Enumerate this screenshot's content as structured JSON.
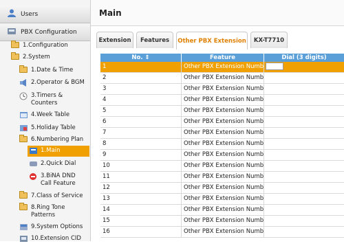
{
  "sidebar": {
    "users_label": "Users",
    "pbx_label": "PBX Configuration",
    "items": [
      {
        "label": "1.Configuration"
      },
      {
        "label": "2.System"
      },
      {
        "label": "1.Date & Time"
      },
      {
        "label": "2.Operator & BGM"
      },
      {
        "label": "3.Timers &"
      },
      {
        "label": "Counters"
      },
      {
        "label": "4.Week Table"
      },
      {
        "label": "5.Holiday Table"
      },
      {
        "label": "6.Numbering Plan"
      },
      {
        "label": "1.Main"
      },
      {
        "label": "2.Quick Dial"
      },
      {
        "label": "3.BiNA DND"
      },
      {
        "label": "Call Feature"
      },
      {
        "label": "7.Class of Service"
      },
      {
        "label": "8.Ring Tone"
      },
      {
        "label": "Patterns"
      },
      {
        "label": "9.System Options"
      },
      {
        "label": "10.Extension CID"
      }
    ]
  },
  "main": {
    "title": "Main",
    "tabs": [
      {
        "label": "Extension"
      },
      {
        "label": "Features"
      },
      {
        "label": "Other PBX Extension"
      },
      {
        "label": "KX-T7710"
      }
    ],
    "grid": {
      "headers": {
        "no": "No.",
        "sort_glyph": "⇕",
        "feature": "Feature",
        "dial": "Dial (3 digits)"
      },
      "rows": [
        {
          "no": "1",
          "feature": "Other PBX Extension Numbering"
        },
        {
          "no": "2",
          "feature": "Other PBX Extension Numbering"
        },
        {
          "no": "3",
          "feature": "Other PBX Extension Numbering"
        },
        {
          "no": "4",
          "feature": "Other PBX Extension Numbering"
        },
        {
          "no": "5",
          "feature": "Other PBX Extension Numbering"
        },
        {
          "no": "6",
          "feature": "Other PBX Extension Numbering"
        },
        {
          "no": "7",
          "feature": "Other PBX Extension Numbering"
        },
        {
          "no": "8",
          "feature": "Other PBX Extension Numbering"
        },
        {
          "no": "9",
          "feature": "Other PBX Extension Numbering"
        },
        {
          "no": "10",
          "feature": "Other PBX Extension Numbering"
        },
        {
          "no": "11",
          "feature": "Other PBX Extension Numbering"
        },
        {
          "no": "12",
          "feature": "Other PBX Extension Numbering"
        },
        {
          "no": "13",
          "feature": "Other PBX Extension Numbering"
        },
        {
          "no": "14",
          "feature": "Other PBX Extension Numbering"
        },
        {
          "no": "15",
          "feature": "Other PBX Extension Numbering"
        },
        {
          "no": "16",
          "feature": "Other PBX Extension Numbering"
        }
      ]
    }
  },
  "colors": {
    "accent": "#f0a000",
    "grid_header": "#5a9fd8",
    "active_tab_text": "#e08000"
  },
  "icons": [
    "user-icon",
    "pbx-icon",
    "folder-icon",
    "folder-open-icon",
    "calendar-icon",
    "timer-icon",
    "table-icon",
    "dial-icon",
    "dnd-icon",
    "extension-icon"
  ]
}
